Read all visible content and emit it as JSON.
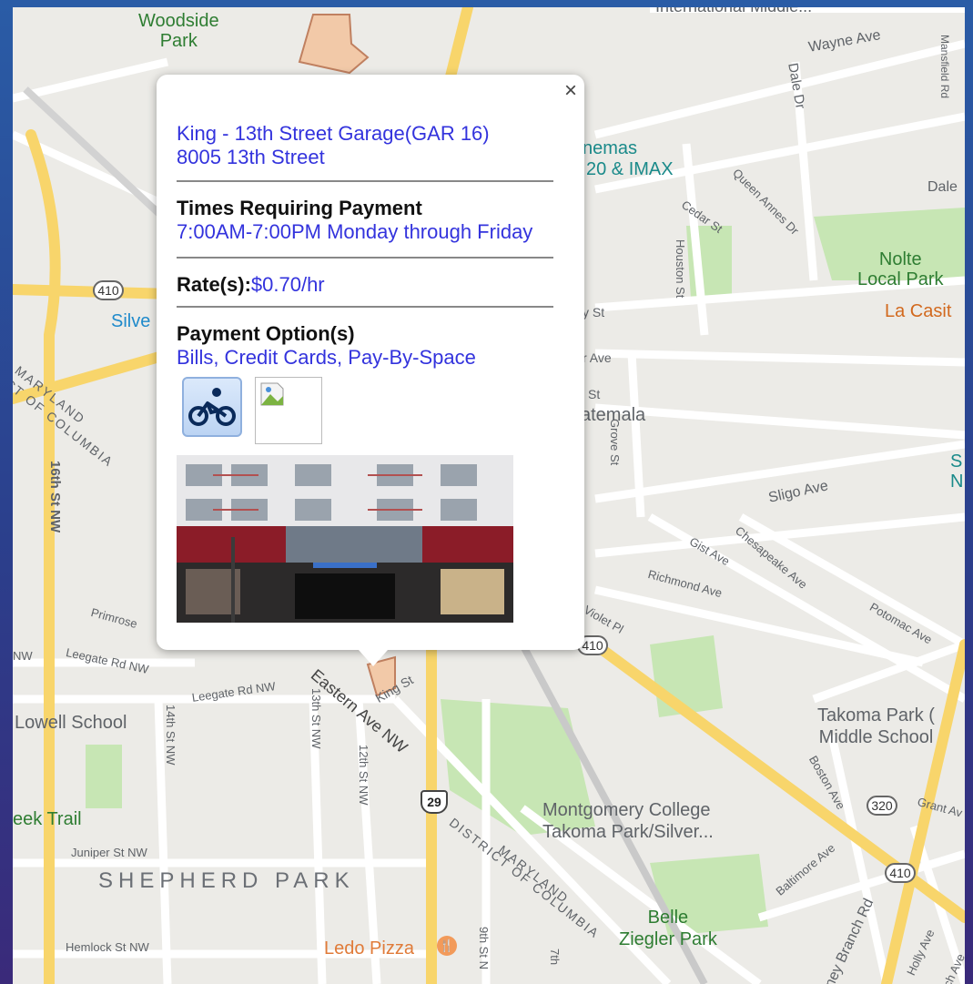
{
  "map": {
    "labels": {
      "woodside_park": "Woodside\nPark",
      "wayne_ave": "Wayne Ave",
      "mansfield_rd": "Mansfield Rd",
      "dale_dr": "Dale Dr",
      "dale": "Dale",
      "cinemas": "nemas",
      "imax": "20 & IMAX",
      "queen_annes_dr": "Queen Annes Dr",
      "cedar_st": "Cedar St",
      "houston_st": "Houston St",
      "nolte_park": "Nolte\nLocal Park",
      "la_casita": "La Casit",
      "silver": "Silve",
      "y_st": "y St",
      "r_ave": "r Ave",
      "st": "St",
      "guatemala": "atemala",
      "grove_st": "Grove St",
      "sligo_ave": "Sligo Ave",
      "s_n": "S\nN",
      "maryland_dc": "MARYLAND\nCT OF COLUMBIA",
      "sixteenth_st": "16th St NW",
      "gist_ave": "Gist Ave",
      "chesapeake_ave": "Chesapeake Ave",
      "richmond_ave": "Richmond Ave",
      "potomac_ave": "Potomac Ave",
      "violet_pl": "Violet Pl",
      "primrose": "Primrose",
      "nw": "NW",
      "leegate_rd_nw": "Leegate Rd NW",
      "leegate_rd_nw2": "Leegate Rd NW",
      "thirteenth_st_nw": "13th St NW",
      "eastern_ave_nw": "Eastern Ave NW",
      "king_st": "King St",
      "lowell_school": "Lowell School",
      "fourteenth_st_nw": "14th St NW",
      "twelfth_st_nw": "12th St NW",
      "takoma_park_ms": "Takoma Park (\nMiddle School",
      "boston_ave": "Boston Ave",
      "grant_ave": "Grant Av",
      "eek_trail": "eek Trail",
      "juniper_st_nw": "Juniper St NW",
      "shepherd_park": "SHEPHERD PARK",
      "montgomery_college": "Montgomery College\nTakoma Park/Silver...",
      "district_maryland": "DISTRICT OF COLUMBIA",
      "maryland2": "MARYLAND",
      "baltimore_ave": "Baltimore Ave",
      "belle_ziegler": "Belle\nZiegler Park",
      "hemlock_st_nw": "Hemlock St NW",
      "ledo_pizza": "Ledo Pizza",
      "ninth_st": "9th St N",
      "seventh": "7th",
      "sligo_creek_pkwy": "ney Branch Rd",
      "holly_ave": "Holly Ave",
      "ch_ave": "ch Ave",
      "international": "International Middle...",
      "shield_410a": "410",
      "shield_410b": "410",
      "shield_410c": "410",
      "shield_320": "320",
      "shield_29": "29"
    },
    "colors": {
      "background": "#ecebe7",
      "road_major": "#f8d56b",
      "road_minor": "#ffffff",
      "park": "#c7e6b4",
      "parcel": "#f2c9a8"
    }
  },
  "popup": {
    "close_label": "×",
    "garage_name": "King - 13th Street Garage(GAR 16)",
    "address": "8005 13th Street",
    "times_heading": "Times Requiring Payment",
    "times_value": "7:00AM-7:00PM Monday through Friday",
    "rates_heading": "Rate(s):",
    "rates_value": "$0.70/hr",
    "payment_heading": "Payment Option(s)",
    "payment_value": "Bills, Credit Cards, Pay-By-Space",
    "icons": [
      "bike-icon",
      "broken-image-icon"
    ],
    "colors": {
      "link": "#3333dd",
      "divider": "#888888"
    }
  }
}
